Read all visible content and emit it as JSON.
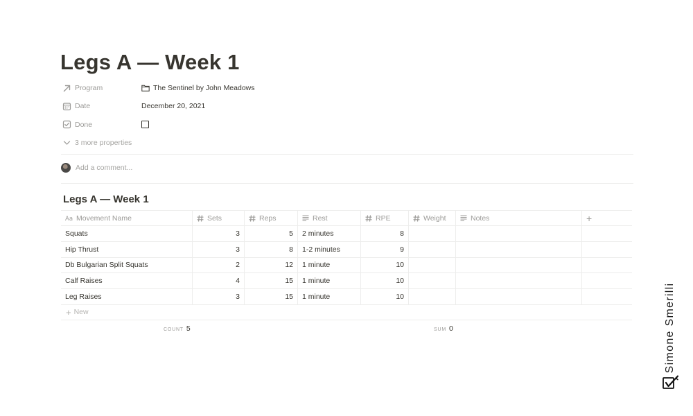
{
  "page": {
    "title": "Legs A — Week 1"
  },
  "properties": {
    "program": {
      "label": "Program",
      "value": "The Sentinel by John Meadows",
      "icon": "relation-arrow-icon"
    },
    "date": {
      "label": "Date",
      "value": "December 20, 2021",
      "icon": "calendar-icon"
    },
    "done": {
      "label": "Done",
      "checked": false,
      "icon": "checkbox-icon"
    },
    "more": "3 more properties"
  },
  "comment": {
    "placeholder": "Add a comment..."
  },
  "database": {
    "title": "Legs A — Week 1",
    "columns": [
      {
        "label": "Movement Name",
        "icon": "text-aa-icon"
      },
      {
        "label": "Sets",
        "icon": "hash-icon"
      },
      {
        "label": "Reps",
        "icon": "hash-icon"
      },
      {
        "label": "Rest",
        "icon": "lines-icon"
      },
      {
        "label": "RPE",
        "icon": "hash-icon"
      },
      {
        "label": "Weight",
        "icon": "hash-icon"
      },
      {
        "label": "Notes",
        "icon": "lines-icon"
      }
    ],
    "rows": [
      {
        "name": "Squats",
        "sets": "3",
        "reps": "5",
        "rest": "2 minutes",
        "rpe": "8",
        "weight": "",
        "notes": ""
      },
      {
        "name": "Hip Thrust",
        "sets": "3",
        "reps": "8",
        "rest": "1-2 minutes",
        "rpe": "9",
        "weight": "",
        "notes": ""
      },
      {
        "name": "Db Bulgarian Split Squats",
        "sets": "2",
        "reps": "12",
        "rest": "1 minute",
        "rpe": "10",
        "weight": "",
        "notes": ""
      },
      {
        "name": "Calf Raises",
        "sets": "4",
        "reps": "15",
        "rest": "1 minute",
        "rpe": "10",
        "weight": "",
        "notes": ""
      },
      {
        "name": "Leg Raises",
        "sets": "3",
        "reps": "15",
        "rest": "1 minute",
        "rpe": "10",
        "weight": "",
        "notes": ""
      }
    ],
    "new_label": "New",
    "add_column": "+",
    "calculations": {
      "count": {
        "label": "COUNT",
        "value": "5"
      },
      "sum": {
        "label": "SUM",
        "value": "0"
      }
    }
  },
  "signature": {
    "text": "Simone Smerilli",
    "logo_icon": "checkbox-pen-logo-icon"
  },
  "colors": {
    "text": "#37352f",
    "muted": "#9b9a97",
    "divider": "#ededec"
  }
}
